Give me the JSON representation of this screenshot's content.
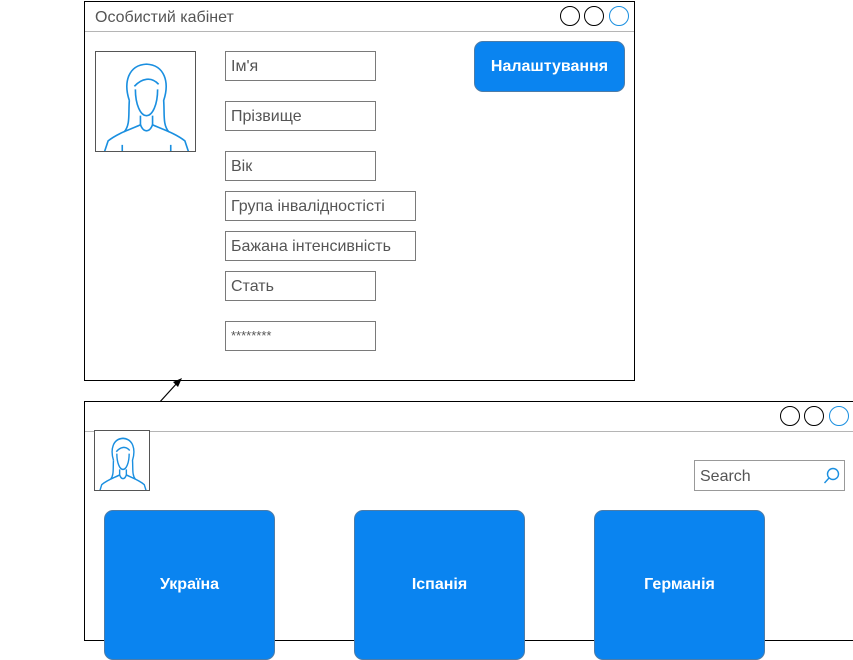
{
  "profile_window": {
    "title": "Особистий кабінет",
    "settings_button": "Налаштування",
    "fields": {
      "name": "Ім'я",
      "surname": "Прізвище",
      "age": "Вік",
      "disability_group": "Група інвалідностісті",
      "desired_intensity": "Бажана інтенсивність",
      "gender": "Стать",
      "password": "********"
    }
  },
  "main_window": {
    "search_placeholder": "Search",
    "countries": [
      "Україна",
      "Іспанія",
      "Германія"
    ]
  },
  "colors": {
    "accent": "#0a84f0",
    "icon_blue": "#1a8fe0"
  },
  "icons": [
    "window-control-icon",
    "avatar-icon",
    "search-icon",
    "arrow-icon"
  ]
}
